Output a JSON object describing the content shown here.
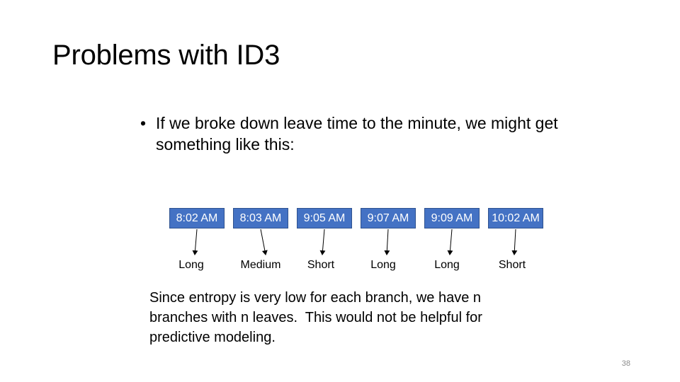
{
  "slide": {
    "title": "Problems with ID3",
    "bullet_text": "If we broke down leave time to the minute, we might get something like this:",
    "bullet_icon": "bullet-dot-icon",
    "tree": {
      "node_color": "#4472c4",
      "nodes": [
        {
          "label": "8:02 AM",
          "leaf": "Long"
        },
        {
          "label": "8:03 AM",
          "leaf": "Medium"
        },
        {
          "label": "9:05 AM",
          "leaf": "Short"
        },
        {
          "label": "9:07 AM",
          "leaf": "Long"
        },
        {
          "label": "9:09 AM",
          "leaf": "Long"
        },
        {
          "label": "10:02 AM",
          "leaf": "Short"
        }
      ]
    },
    "note": "Since entropy is very low for each branch, we have n\nbranches with n leaves.  This would not be helpful for\npredictive modeling.",
    "page_number": "38"
  }
}
